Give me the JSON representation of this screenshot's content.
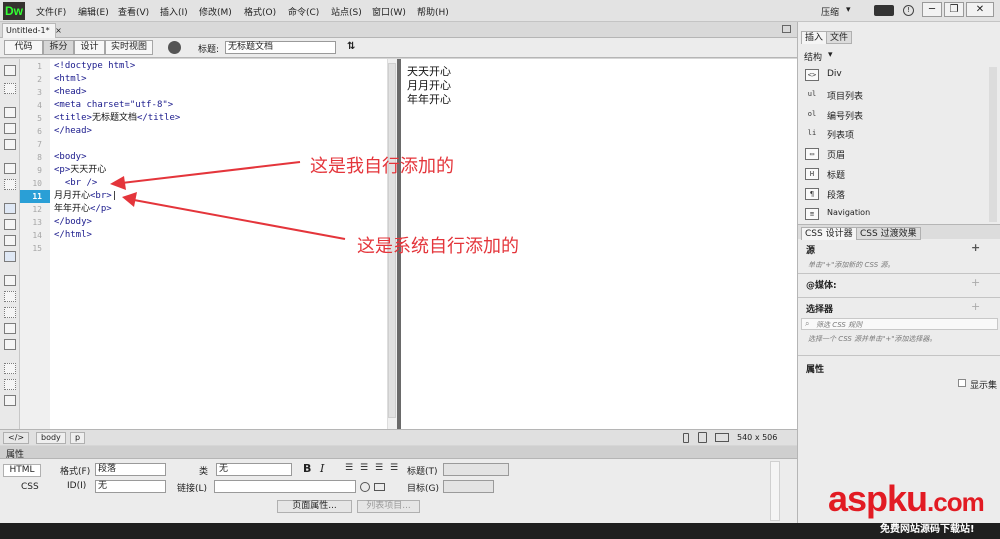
{
  "menubar": {
    "logo": "Dw",
    "items": [
      "文件(F)",
      "编辑(E)",
      "查看(V)",
      "插入(I)",
      "修改(M)",
      "格式(O)",
      "命令(C)",
      "站点(S)",
      "窗口(W)",
      "帮助(H)"
    ],
    "workspace": "压缩",
    "workspace_caret": "▾",
    "window_controls": [
      "─",
      "❐",
      "✕"
    ]
  },
  "document": {
    "tab_title": "Untitled-1*",
    "tab_close": "×"
  },
  "toolbar": {
    "views": [
      "代码",
      "拆分",
      "设计",
      "实时视图"
    ],
    "active_view": "拆分",
    "title_label": "标题:",
    "title_value": "无标题文档"
  },
  "code_view": {
    "line_numbers": [
      "1",
      "2",
      "3",
      "4",
      "5",
      "6",
      "7",
      "8",
      "9",
      "10",
      "11",
      "12",
      "13",
      "14",
      "15"
    ],
    "current_line": "11",
    "lines": [
      {
        "n": "1",
        "tag": "<!doctype html>",
        "txt": ""
      },
      {
        "n": "2",
        "tag": "<html>",
        "txt": ""
      },
      {
        "n": "3",
        "tag": "<head>",
        "txt": ""
      },
      {
        "n": "4",
        "tag": "<meta charset=\"utf-8\">",
        "txt": ""
      },
      {
        "n": "5",
        "tag": "<title>",
        "txt": "无标题文档",
        "tag2": "</title>"
      },
      {
        "n": "6",
        "tag": "</head>",
        "txt": ""
      },
      {
        "n": "7",
        "tag": "",
        "txt": ""
      },
      {
        "n": "8",
        "tag": "<body>",
        "txt": ""
      },
      {
        "n": "9",
        "tag": "<p>",
        "txt": "天天开心"
      },
      {
        "n": "10",
        "tag": "  <br />",
        "txt": ""
      },
      {
        "n": "11",
        "tag": "",
        "txt": "月月开心",
        "tag2": "<br>"
      },
      {
        "n": "12",
        "tag": "",
        "txt": "年年开心",
        "tag2": "</p>"
      },
      {
        "n": "13",
        "tag": "</body>",
        "txt": ""
      },
      {
        "n": "14",
        "tag": "</html>",
        "txt": ""
      },
      {
        "n": "15",
        "tag": "",
        "txt": ""
      }
    ]
  },
  "design_view": {
    "lines": [
      "天天开心",
      "月月开心",
      "年年开心"
    ]
  },
  "annotations": {
    "first": "这是我自行添加的",
    "second": "这是系统自行添加的",
    "color": "#e4353b"
  },
  "statusbar": {
    "tags": [
      "body",
      "p"
    ],
    "code_icon": "</>",
    "dimensions": "540 x 506"
  },
  "properties": {
    "header": "属性",
    "html_btn": "HTML",
    "css_btn": "CSS",
    "format_label": "格式(F)",
    "format_value": "段落",
    "class_label": "类",
    "class_value": "无",
    "id_label": "ID(I)",
    "id_value": "无",
    "link_label": "链接(L)",
    "link_value": "",
    "title_label": "标题(T)",
    "target_label": "目标(G)",
    "page_props": "页面属性...",
    "list_item": "列表项目..."
  },
  "right_panel": {
    "tabs": [
      "插入",
      "文件"
    ],
    "category": "结构",
    "insert_items": [
      {
        "icon": "<>",
        "label": "Div"
      },
      {
        "icon": "ul",
        "label": "项目列表"
      },
      {
        "icon": "ol",
        "label": "编号列表"
      },
      {
        "icon": "li",
        "label": "列表项"
      },
      {
        "icon": "▭",
        "label": "页眉"
      },
      {
        "icon": "H",
        "label": "标题"
      },
      {
        "icon": "¶",
        "label": "段落"
      },
      {
        "icon": "≡",
        "label": "Navigation"
      }
    ],
    "css_tabs": [
      "CSS 设计器",
      "CSS 过渡效果"
    ],
    "source_title": "源",
    "source_hint": "单击\"+\"添加新的 CSS 源。",
    "media_title": "@媒体:",
    "selector_title": "选择器",
    "selector_filter": "筛选 CSS 规则",
    "selector_hint": "选择一个 CSS 源并单击\"+\"添加选择器。",
    "props_title": "属性",
    "show_set": "显示集"
  },
  "watermark": {
    "brand": "aspku",
    "dot_com": ".com",
    "tagline": "免费网站源码下载站!"
  }
}
